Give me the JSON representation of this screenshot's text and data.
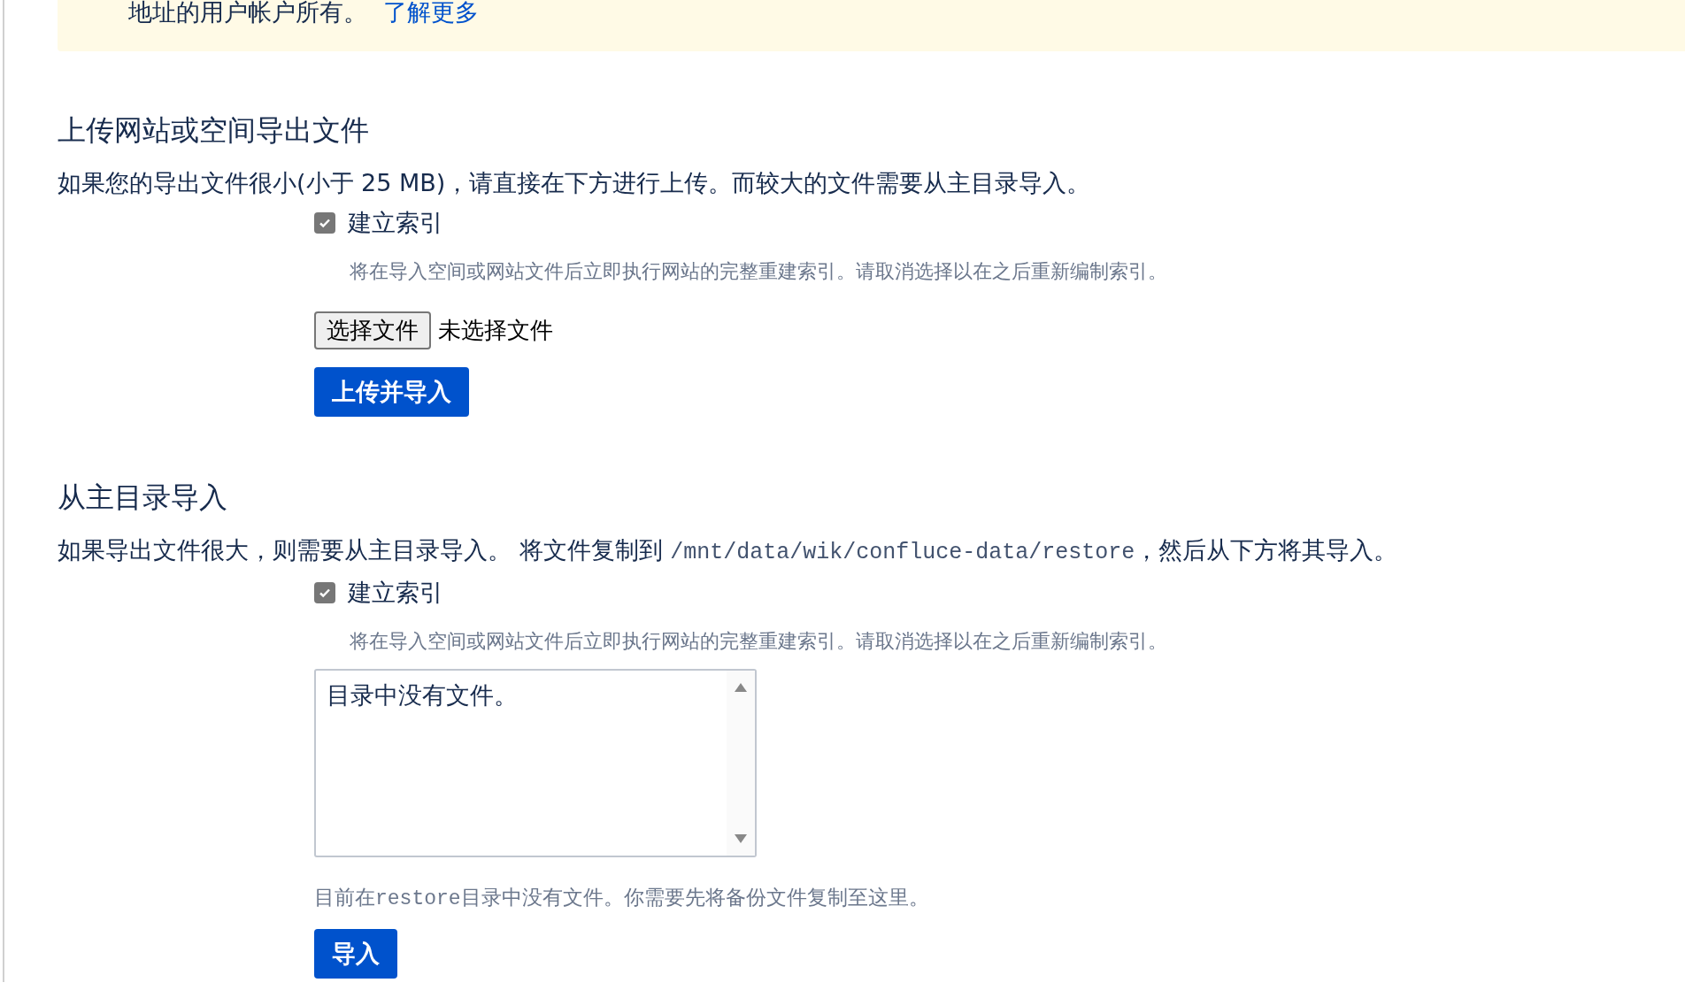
{
  "banner": {
    "text": "地址的用户帐户所有。",
    "link": "了解更多"
  },
  "upload_section": {
    "heading": "上传网站或空间导出文件",
    "description": "如果您的导出文件很小(小于 25 MB)，请直接在下方进行上传。而较大的文件需要从主目录导入。",
    "index_checkbox": {
      "label": "建立索引",
      "checked": true
    },
    "index_help": "将在导入空间或网站文件后立即执行网站的完整重建索引。请取消选择以在之后重新编制索引。",
    "file_button": "选择文件",
    "file_status": "未选择文件",
    "submit_button": "上传并导入"
  },
  "home_section": {
    "heading": "从主目录导入",
    "description_before": "如果导出文件很大，则需要从主目录导入。 将文件复制到 ",
    "description_path": "/mnt/data/wik/confluce-data/restore",
    "description_after": "，然后从下方将其导入。",
    "index_checkbox": {
      "label": "建立索引",
      "checked": true
    },
    "index_help": "将在导入空间或网站文件后立即执行网站的完整重建索引。请取消选择以在之后重新编制索引。",
    "file_list": [
      "目录中没有文件。"
    ],
    "note_before": "目前在",
    "note_code": "restore",
    "note_after": "目录中没有文件。你需要先将备份文件复制至这里。",
    "submit_button": "导入"
  }
}
